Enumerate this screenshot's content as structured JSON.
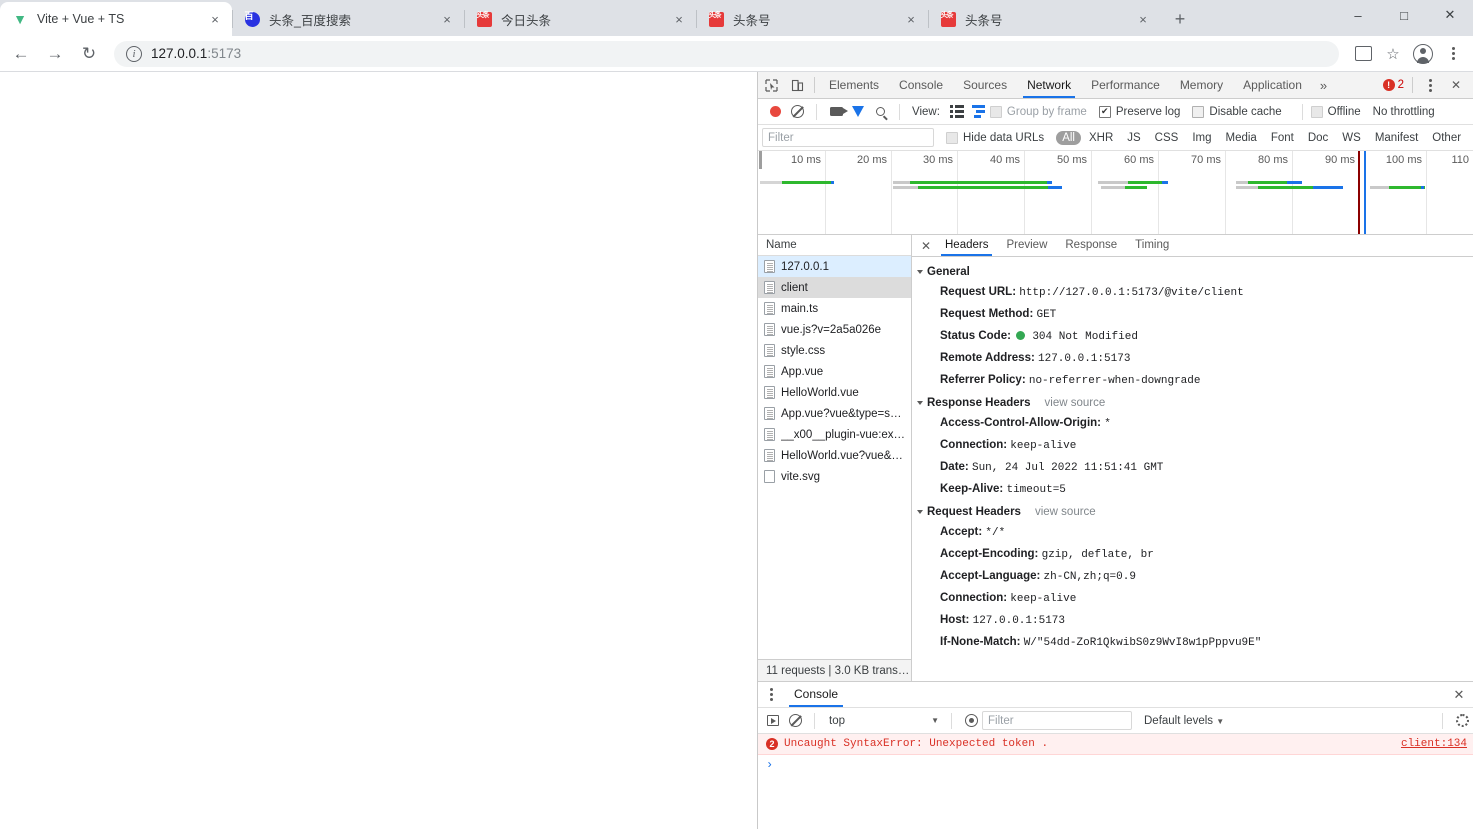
{
  "browser": {
    "tabs": [
      {
        "title": "Vite + Vue + TS",
        "favicon": "vite-icon",
        "active": true
      },
      {
        "title": "头条_百度搜索",
        "favicon": "baidu-icon",
        "active": false
      },
      {
        "title": "今日头条",
        "favicon": "toutiao-icon",
        "active": false
      },
      {
        "title": "头条号",
        "favicon": "toutiao-icon",
        "active": false
      },
      {
        "title": "头条号",
        "favicon": "toutiao-icon",
        "active": false
      }
    ],
    "new_tab_label": "+",
    "tab_close_label": "×",
    "window_controls": {
      "minimize": "–",
      "maximize": "□",
      "close": "✕"
    },
    "nav": {
      "back": "←",
      "forward": "→",
      "reload": "↻"
    },
    "omnibox": {
      "info_icon": "i",
      "url_host": "127.0.0.1",
      "url_port": ":5173",
      "full_url": "127.0.0.1:5173"
    },
    "toolbar_icons": {
      "translate": "translate-icon",
      "bookmark": "☆",
      "profile": "profile-avatar",
      "menu": "kebab-menu"
    }
  },
  "devtools": {
    "main_tabs": [
      {
        "label": "Elements",
        "active": false
      },
      {
        "label": "Console",
        "active": false
      },
      {
        "label": "Sources",
        "active": false
      },
      {
        "label": "Network",
        "active": true
      },
      {
        "label": "Performance",
        "active": false
      },
      {
        "label": "Memory",
        "active": false
      },
      {
        "label": "Application",
        "active": false
      }
    ],
    "overflow_label": "»",
    "error_count": "2",
    "close_label": "✕",
    "network_toolbar": {
      "view_label": "View:",
      "group_by_frame": "Group by frame",
      "preserve_log": "Preserve log",
      "disable_cache": "Disable cache",
      "offline": "Offline",
      "throttling": "No throttling"
    },
    "filter_bar": {
      "filter_placeholder": "Filter",
      "hide_data_urls": "Hide data URLs",
      "types": [
        "All",
        "XHR",
        "JS",
        "CSS",
        "Img",
        "Media",
        "Font",
        "Doc",
        "WS",
        "Manifest",
        "Other"
      ],
      "active_type": "All"
    },
    "overview": {
      "ticks": [
        "10 ms",
        "20 ms",
        "30 ms",
        "40 ms",
        "50 ms",
        "60 ms",
        "70 ms",
        "80 ms",
        "90 ms",
        "100 ms",
        "110"
      ]
    },
    "requests": {
      "column_header": "Name",
      "rows": [
        {
          "name": "127.0.0.1",
          "state": "highlight"
        },
        {
          "name": "client",
          "state": "selected"
        },
        {
          "name": "main.ts",
          "state": ""
        },
        {
          "name": "vue.js?v=2a5a026e",
          "state": ""
        },
        {
          "name": "style.css",
          "state": ""
        },
        {
          "name": "App.vue",
          "state": ""
        },
        {
          "name": "HelloWorld.vue",
          "state": ""
        },
        {
          "name": "App.vue?vue&type=s…",
          "state": ""
        },
        {
          "name": "__x00__plugin-vue:exp…",
          "state": ""
        },
        {
          "name": "HelloWorld.vue?vue&…",
          "state": ""
        },
        {
          "name": "vite.svg",
          "state": ""
        }
      ],
      "status_text": "11 requests  |  3.0 KB trans…"
    },
    "detail": {
      "tabs": [
        {
          "label": "Headers",
          "active": true
        },
        {
          "label": "Preview",
          "active": false
        },
        {
          "label": "Response",
          "active": false
        },
        {
          "label": "Timing",
          "active": false
        }
      ],
      "close_label": "✕",
      "sections": [
        {
          "title": "General",
          "view_source": "",
          "rows": [
            {
              "key": "Request URL:",
              "value": "http://127.0.0.1:5173/@vite/client",
              "dot": false
            },
            {
              "key": "Request Method:",
              "value": "GET",
              "dot": false
            },
            {
              "key": "Status Code:",
              "value": "304 Not Modified",
              "dot": true
            },
            {
              "key": "Remote Address:",
              "value": "127.0.0.1:5173",
              "dot": false
            },
            {
              "key": "Referrer Policy:",
              "value": "no-referrer-when-downgrade",
              "dot": false
            }
          ]
        },
        {
          "title": "Response Headers",
          "view_source": "view source",
          "rows": [
            {
              "key": "Access-Control-Allow-Origin:",
              "value": "*",
              "dot": false
            },
            {
              "key": "Connection:",
              "value": "keep-alive",
              "dot": false
            },
            {
              "key": "Date:",
              "value": "Sun, 24 Jul 2022 11:51:41 GMT",
              "dot": false
            },
            {
              "key": "Keep-Alive:",
              "value": "timeout=5",
              "dot": false
            }
          ]
        },
        {
          "title": "Request Headers",
          "view_source": "view source",
          "rows": [
            {
              "key": "Accept:",
              "value": "*/*",
              "dot": false
            },
            {
              "key": "Accept-Encoding:",
              "value": "gzip, deflate, br",
              "dot": false
            },
            {
              "key": "Accept-Language:",
              "value": "zh-CN,zh;q=0.9",
              "dot": false
            },
            {
              "key": "Connection:",
              "value": "keep-alive",
              "dot": false
            },
            {
              "key": "Host:",
              "value": "127.0.0.1:5173",
              "dot": false
            },
            {
              "key": "If-None-Match:",
              "value": "W/\"54dd-ZoR1QkwibS0z9WvI8w1pPppvu9E\"",
              "dot": false
            }
          ]
        }
      ]
    },
    "drawer": {
      "tab_label": "Console",
      "close_label": "✕",
      "context": "top",
      "filter_placeholder": "Filter",
      "levels_label": "Default levels",
      "caret": "▾",
      "messages": [
        {
          "count": "2",
          "text": "Uncaught SyntaxError: Unexpected token .",
          "source": "client:134"
        }
      ],
      "prompt": "›"
    }
  }
}
